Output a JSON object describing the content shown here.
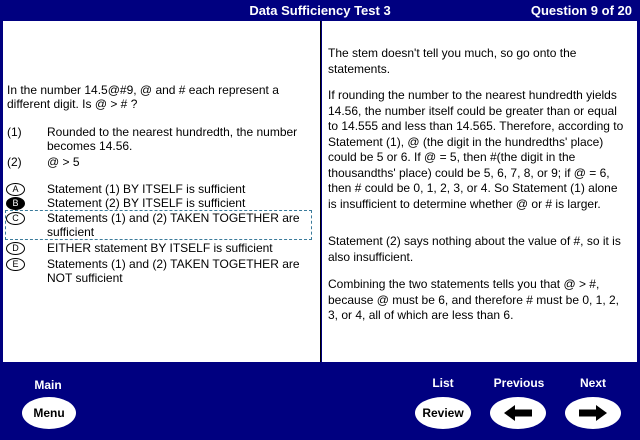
{
  "header": {
    "title": "Data Sufficiency Test 3",
    "counter": "Question 9 of 20"
  },
  "question": {
    "stem": "In the number 14.5@#9, @ and # each represent a different digit. Is @ > # ?",
    "statements": [
      {
        "num": "(1)",
        "text": "Rounded to the nearest hundredth, the number becomes 14.56."
      },
      {
        "num": "(2)",
        "text": "@ > 5"
      }
    ],
    "choices": [
      {
        "letter": "A",
        "text": "Statement (1) BY ITSELF is sufficient"
      },
      {
        "letter": "B",
        "text": "Statement (2) BY ITSELF is sufficient"
      },
      {
        "letter": "C",
        "text": "Statements (1) and (2) TAKEN TOGETHER are sufficient"
      },
      {
        "letter": "D",
        "text": "EITHER statement BY ITSELF is sufficient"
      },
      {
        "letter": "E",
        "text": "Statements (1) and (2) TAKEN TOGETHER are NOT sufficient"
      }
    ],
    "selected_choice": "B",
    "focused_choice": "C"
  },
  "explanation": {
    "paragraphs": [
      "The stem doesn't tell you much, so go onto the statements.",
      "If rounding the number to the nearest hundredth yields 14.56, the number itself could be greater than or equal to 14.555 and less than 14.565. Therefore, according to Statement (1), @ (the digit in the hundredths' place) could be 5 or 6. If @ = 5, then #(the digit in the thousandths' place) could be 5, 6, 7, 8, or 9; if @ = 6, then # could be 0, 1, 2, 3, or 4. So Statement (1) alone is insufficient to determine whether @ or # is larger.",
      "Statement (2) says nothing about the value of #, so it is also insufficient.",
      "Combining the two statements tells you that @ > #, because @ must be 6, and therefore # must be 0, 1, 2, 3, or 4, all of which are less than 6."
    ]
  },
  "nav": {
    "main_label": "Main",
    "main_button": "Menu",
    "list_label": "List",
    "list_button": "Review",
    "previous_label": "Previous",
    "next_label": "Next",
    "previous_icon": "left-arrow-icon",
    "next_icon": "right-arrow-icon"
  }
}
